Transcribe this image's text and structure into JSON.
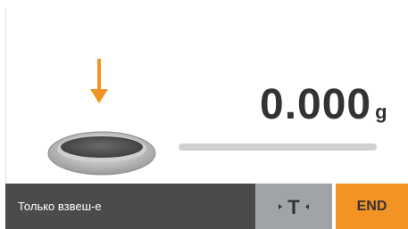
{
  "display": {
    "weight_value": "0.000",
    "weight_unit": "g",
    "capacity_fraction": 0
  },
  "status_bar": {
    "mode_label": "Только взвеш-е",
    "tare_label": "T",
    "end_label": "END"
  },
  "icons": {
    "load_arrow": "down-arrow-icon",
    "weighing_pan": "weighing-pan-icon",
    "tare": "tare-icon"
  },
  "colors": {
    "accent": "#f39324",
    "status_bar_bg": "#4b4b4b",
    "tare_button_bg": "#a0a3a8",
    "text": "#333333"
  }
}
